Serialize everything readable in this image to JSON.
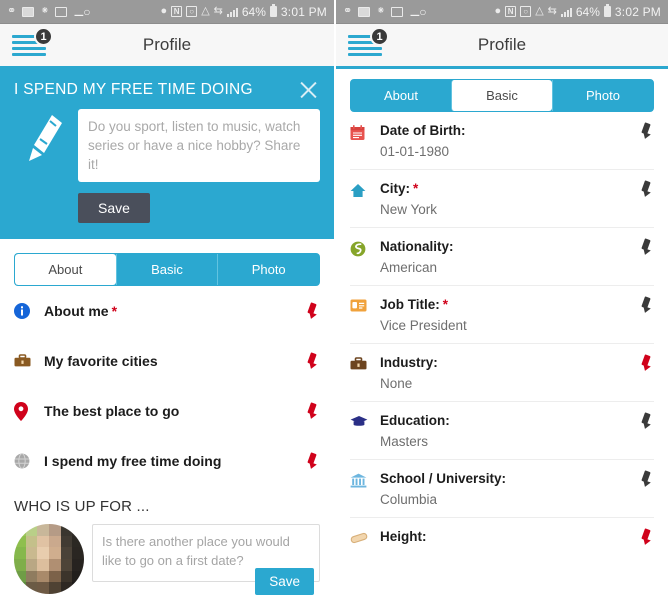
{
  "left": {
    "status_bar": {
      "left_icons": [
        "location-outline-icon",
        "mail-icon",
        "checkmark-list-icon",
        "image-icon",
        "key-icon"
      ],
      "right_icons": [
        "location-icon",
        "nfc-icon",
        "alarm-icon",
        "wifi-icon",
        "sync-icon",
        "signal-icon"
      ],
      "battery_percent": "64%",
      "time": "3:01 PM"
    },
    "header": {
      "title": "Profile",
      "menu_badge": "1"
    },
    "promo": {
      "title": "I SPEND MY FREE TIME DOING",
      "input_placeholder": "Do you sport, listen to music, watch series or have a nice hobby? Share it!",
      "input_value": "",
      "save_label": "Save",
      "close_icon": "close-icon",
      "pencil_icon": "pencil-icon"
    },
    "tabs": [
      {
        "label": "About",
        "active": true
      },
      {
        "label": "Basic",
        "active": false
      },
      {
        "label": "Photo",
        "active": false
      }
    ],
    "about_items": [
      {
        "label": "About me",
        "required": true,
        "icon": "info-icon",
        "icon_color": "#1565d8",
        "edit_icon": "pencil-edit-icon",
        "edit_color": "red"
      },
      {
        "label": "My favorite cities",
        "required": false,
        "icon": "briefcase-icon",
        "icon_color": "#8a5a22",
        "edit_icon": "pencil-edit-icon",
        "edit_color": "red"
      },
      {
        "label": "The best place to go",
        "required": false,
        "icon": "map-pin-icon",
        "icon_color": "#d0021b",
        "edit_icon": "pencil-edit-icon",
        "edit_color": "red"
      },
      {
        "label": "I spend my free time doing",
        "required": false,
        "icon": "globe-icon",
        "icon_color": "#9b9b9b",
        "edit_icon": "pencil-edit-icon",
        "edit_color": "red"
      }
    ],
    "who_up": {
      "title": "WHO IS UP FOR ...",
      "input_placeholder": "Is there another place you would like to go on a first date?",
      "input_value": "",
      "save_label": "Save",
      "avatar": "blurred-avatar"
    }
  },
  "right": {
    "status_bar": {
      "left_icons": [
        "location-outline-icon",
        "mail-icon",
        "checkmark-list-icon",
        "image-icon",
        "key-icon"
      ],
      "right_icons": [
        "location-icon",
        "nfc-icon",
        "alarm-icon",
        "wifi-icon",
        "sync-icon",
        "signal-icon"
      ],
      "battery_percent": "64%",
      "time": "3:02 PM"
    },
    "header": {
      "title": "Profile",
      "menu_badge": "1"
    },
    "tabs": [
      {
        "label": "About",
        "active": false
      },
      {
        "label": "Basic",
        "active": true
      },
      {
        "label": "Photo",
        "active": false
      }
    ],
    "basic_items": [
      {
        "label": "Date of Birth:",
        "value": "01-01-1980",
        "required": false,
        "icon": "calendar-icon",
        "edit_color": "dark"
      },
      {
        "label": "City:",
        "value": "New York",
        "required": true,
        "icon": "home-icon",
        "edit_color": "dark"
      },
      {
        "label": "Nationality:",
        "value": "American",
        "required": false,
        "icon": "globe-green-icon",
        "edit_color": "dark"
      },
      {
        "label": "Job Title:",
        "value": "Vice President",
        "required": true,
        "icon": "id-card-icon",
        "edit_color": "dark"
      },
      {
        "label": "Industry:",
        "value": "None",
        "required": false,
        "icon": "briefcase-icon",
        "edit_color": "red"
      },
      {
        "label": "Education:",
        "value": "Masters",
        "required": false,
        "icon": "graduation-cap-icon",
        "edit_color": "dark"
      },
      {
        "label": "School / University:",
        "value": "Columbia",
        "required": false,
        "icon": "bank-icon",
        "edit_color": "dark"
      },
      {
        "label": "Height:",
        "value": "",
        "required": false,
        "icon": "ruler-icon",
        "edit_color": "red"
      }
    ]
  },
  "theme": {
    "accent": "#2ba8d0",
    "dark_button": "#4a4f5b",
    "required_star": "#d0021b",
    "status_bar": "#9a9a9a"
  }
}
